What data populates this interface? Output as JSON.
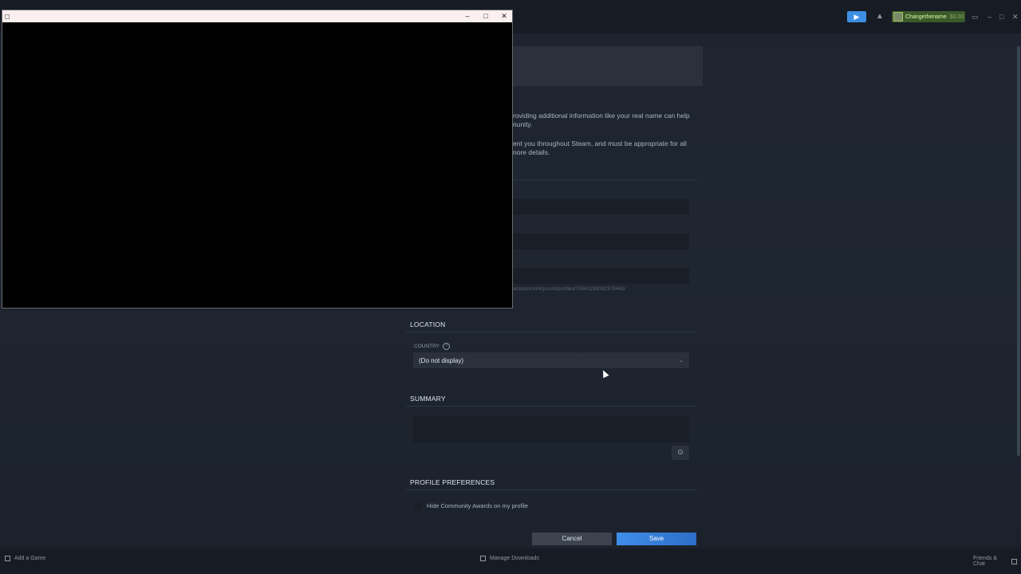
{
  "topbar": {
    "user_name": "Changethename",
    "balance": "$0.00"
  },
  "content": {
    "desc_line1": "roviding additional information like your real name can help",
    "desc_line2": "nunity.",
    "desc_line3": "ent you throughout Steam, and must be appropriate for all",
    "desc_line4": "nore details.",
    "url_hint": "amcommunity.com/profiles/76561199082378463/"
  },
  "location": {
    "title": "LOCATION",
    "country_label": "COUNTRY",
    "country_value": "(Do not display)"
  },
  "summary": {
    "title": "SUMMARY"
  },
  "preferences": {
    "title": "PROFILE PREFERENCES",
    "hide_awards_label": "Hide Community Awards on my profile"
  },
  "buttons": {
    "cancel": "Cancel",
    "save": "Save"
  },
  "bottombar": {
    "add_game": "Add a Game",
    "manage_downloads": "Manage Downloads",
    "friends_chat": "Friends & Chat"
  },
  "colors": {
    "accent_blue": "#3d8fe3",
    "save_blue": "#3f8ee8",
    "background": "#1b2230"
  }
}
